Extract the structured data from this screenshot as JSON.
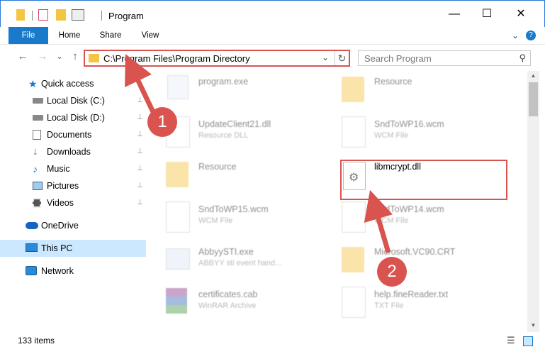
{
  "window": {
    "title": "Program",
    "minimize_glyph": "—",
    "maximize_glyph": "☐",
    "close_glyph": "✕"
  },
  "ribbon": {
    "tabs": [
      "File",
      "Home",
      "Share",
      "View"
    ],
    "collapse_glyph": "⌄",
    "help_glyph": "?"
  },
  "nav": {
    "back_glyph": "←",
    "forward_glyph": "→",
    "recent_glyph": "⌄",
    "up_glyph": "↑"
  },
  "address": {
    "path": "C:\\Program Files\\Program Directory",
    "dropdown_glyph": "⌄",
    "refresh_glyph": "↻"
  },
  "search": {
    "placeholder": "Search Program",
    "icon_glyph": "⚲"
  },
  "sidebar": {
    "items": [
      {
        "label": "Quick access",
        "icon": "star-icon",
        "pinned": false
      },
      {
        "label": "Local Disk (C:)",
        "icon": "drive-icon",
        "pinned": true
      },
      {
        "label": "Local Disk (D:)",
        "icon": "drive-icon",
        "pinned": true
      },
      {
        "label": "Documents",
        "icon": "documents-icon",
        "pinned": true
      },
      {
        "label": "Downloads",
        "icon": "download-icon",
        "pinned": true
      },
      {
        "label": "Music",
        "icon": "music-icon",
        "pinned": true
      },
      {
        "label": "Pictures",
        "icon": "pictures-icon",
        "pinned": true
      },
      {
        "label": "Videos",
        "icon": "videos-icon",
        "pinned": true
      },
      {
        "label": "OneDrive",
        "icon": "cloud-icon",
        "pinned": false
      },
      {
        "label": "This PC",
        "icon": "computer-icon",
        "pinned": false
      },
      {
        "label": "Network",
        "icon": "network-icon",
        "pinned": false
      }
    ],
    "pin_glyph": "📌"
  },
  "files": [
    {
      "name": "program.exe",
      "type": "",
      "icon": "exe-icon"
    },
    {
      "name": "Resource",
      "type": "",
      "icon": "folder-icon"
    },
    {
      "name": "UpdateClient21.dll",
      "type": "Resource DLL",
      "icon": "dll-icon"
    },
    {
      "name": "SndToWP16.wcm",
      "type": "WCM File",
      "icon": "file-icon"
    },
    {
      "name": "Resource",
      "type": "",
      "icon": "folder-icon"
    },
    {
      "name": "libmcrypt.dll",
      "type": "",
      "icon": "dll-icon"
    },
    {
      "name": "SndToWP15.wcm",
      "type": "WCM File",
      "icon": "file-icon"
    },
    {
      "name": "SndToWP14.wcm",
      "type": "WCM File",
      "icon": "file-icon"
    },
    {
      "name": "AbbyySTI.exe",
      "type": "ABBYY sti event hand...",
      "icon": "exe-icon"
    },
    {
      "name": "Microsoft.VC90.CRT",
      "type": "",
      "icon": "folder-icon"
    },
    {
      "name": "certificates.cab",
      "type": "WinRAR Archive",
      "icon": "archive-icon"
    },
    {
      "name": "help.fineReader.txt",
      "type": "TXT File",
      "icon": "text-file-icon"
    }
  ],
  "annotations": {
    "badge_1": "1",
    "badge_2": "2"
  },
  "status": {
    "item_count": "133 items"
  },
  "colors": {
    "accent": "#1979ca",
    "highlight_red": "#d9534f",
    "selected_bg": "#cce8ff",
    "folder": "#f4c542"
  }
}
